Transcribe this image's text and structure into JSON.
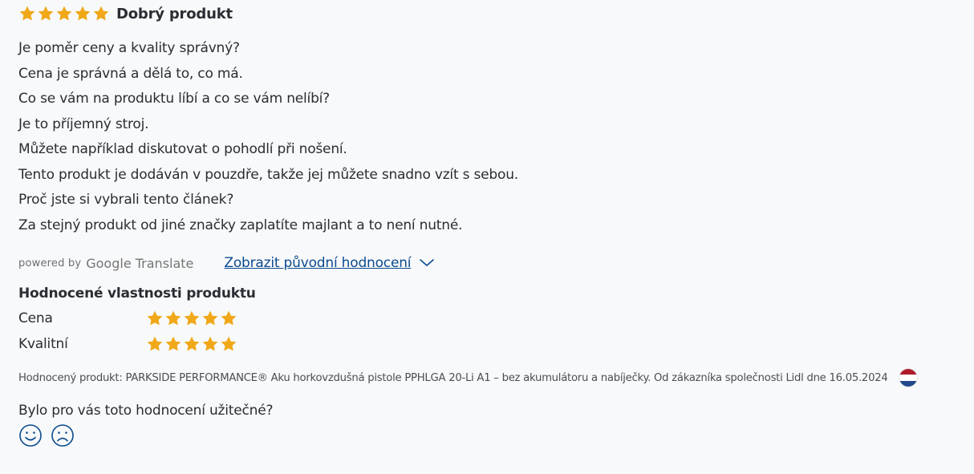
{
  "review": {
    "rating_stars": 5,
    "title": "Dobrý produkt",
    "lines": [
      "Je poměr ceny a kvality správný?",
      "Cena je správná a dělá to, co má.",
      "Co se vám na produktu líbí a co se vám nelíbí?",
      "Je to příjemný stroj.",
      "Můžete například diskutovat o pohodlí při nošení.",
      "Tento produkt je dodáván v pouzdře, takže jej můžete snadno vzít s sebou.",
      "Proč jste si vybrali tento článek?",
      "Za stejný produkt od jiné značky zaplatíte majlant a to není nutné."
    ]
  },
  "translation": {
    "powered_by": "powered by",
    "provider": "Google Translate",
    "show_original": "Zobrazit původní hodnocení"
  },
  "properties": {
    "title": "Hodnocené vlastnosti produktu",
    "items": [
      {
        "label": "Cena",
        "stars": 5
      },
      {
        "label": "Kvalitní",
        "stars": 5
      }
    ]
  },
  "rated_product": {
    "text": "Hodnocený produkt: PARKSIDE PERFORMANCE® Aku horkovzdušná pistole PPHLGA 20-Li A1 – bez akumulátoru a nabíječky. Od zákazníka společnosti Lidl dne 16.05.2024",
    "flag": "netherlands-flag-icon"
  },
  "helpful": {
    "question": "Bylo pro vás toto hodnocení užitečné?",
    "yes_icon": "smiley-happy-icon",
    "no_icon": "smiley-sad-icon"
  },
  "colors": {
    "star": "#f0a818",
    "link": "#0b4a8f",
    "text": "#2a2d33",
    "background": "#f8f9fa"
  }
}
